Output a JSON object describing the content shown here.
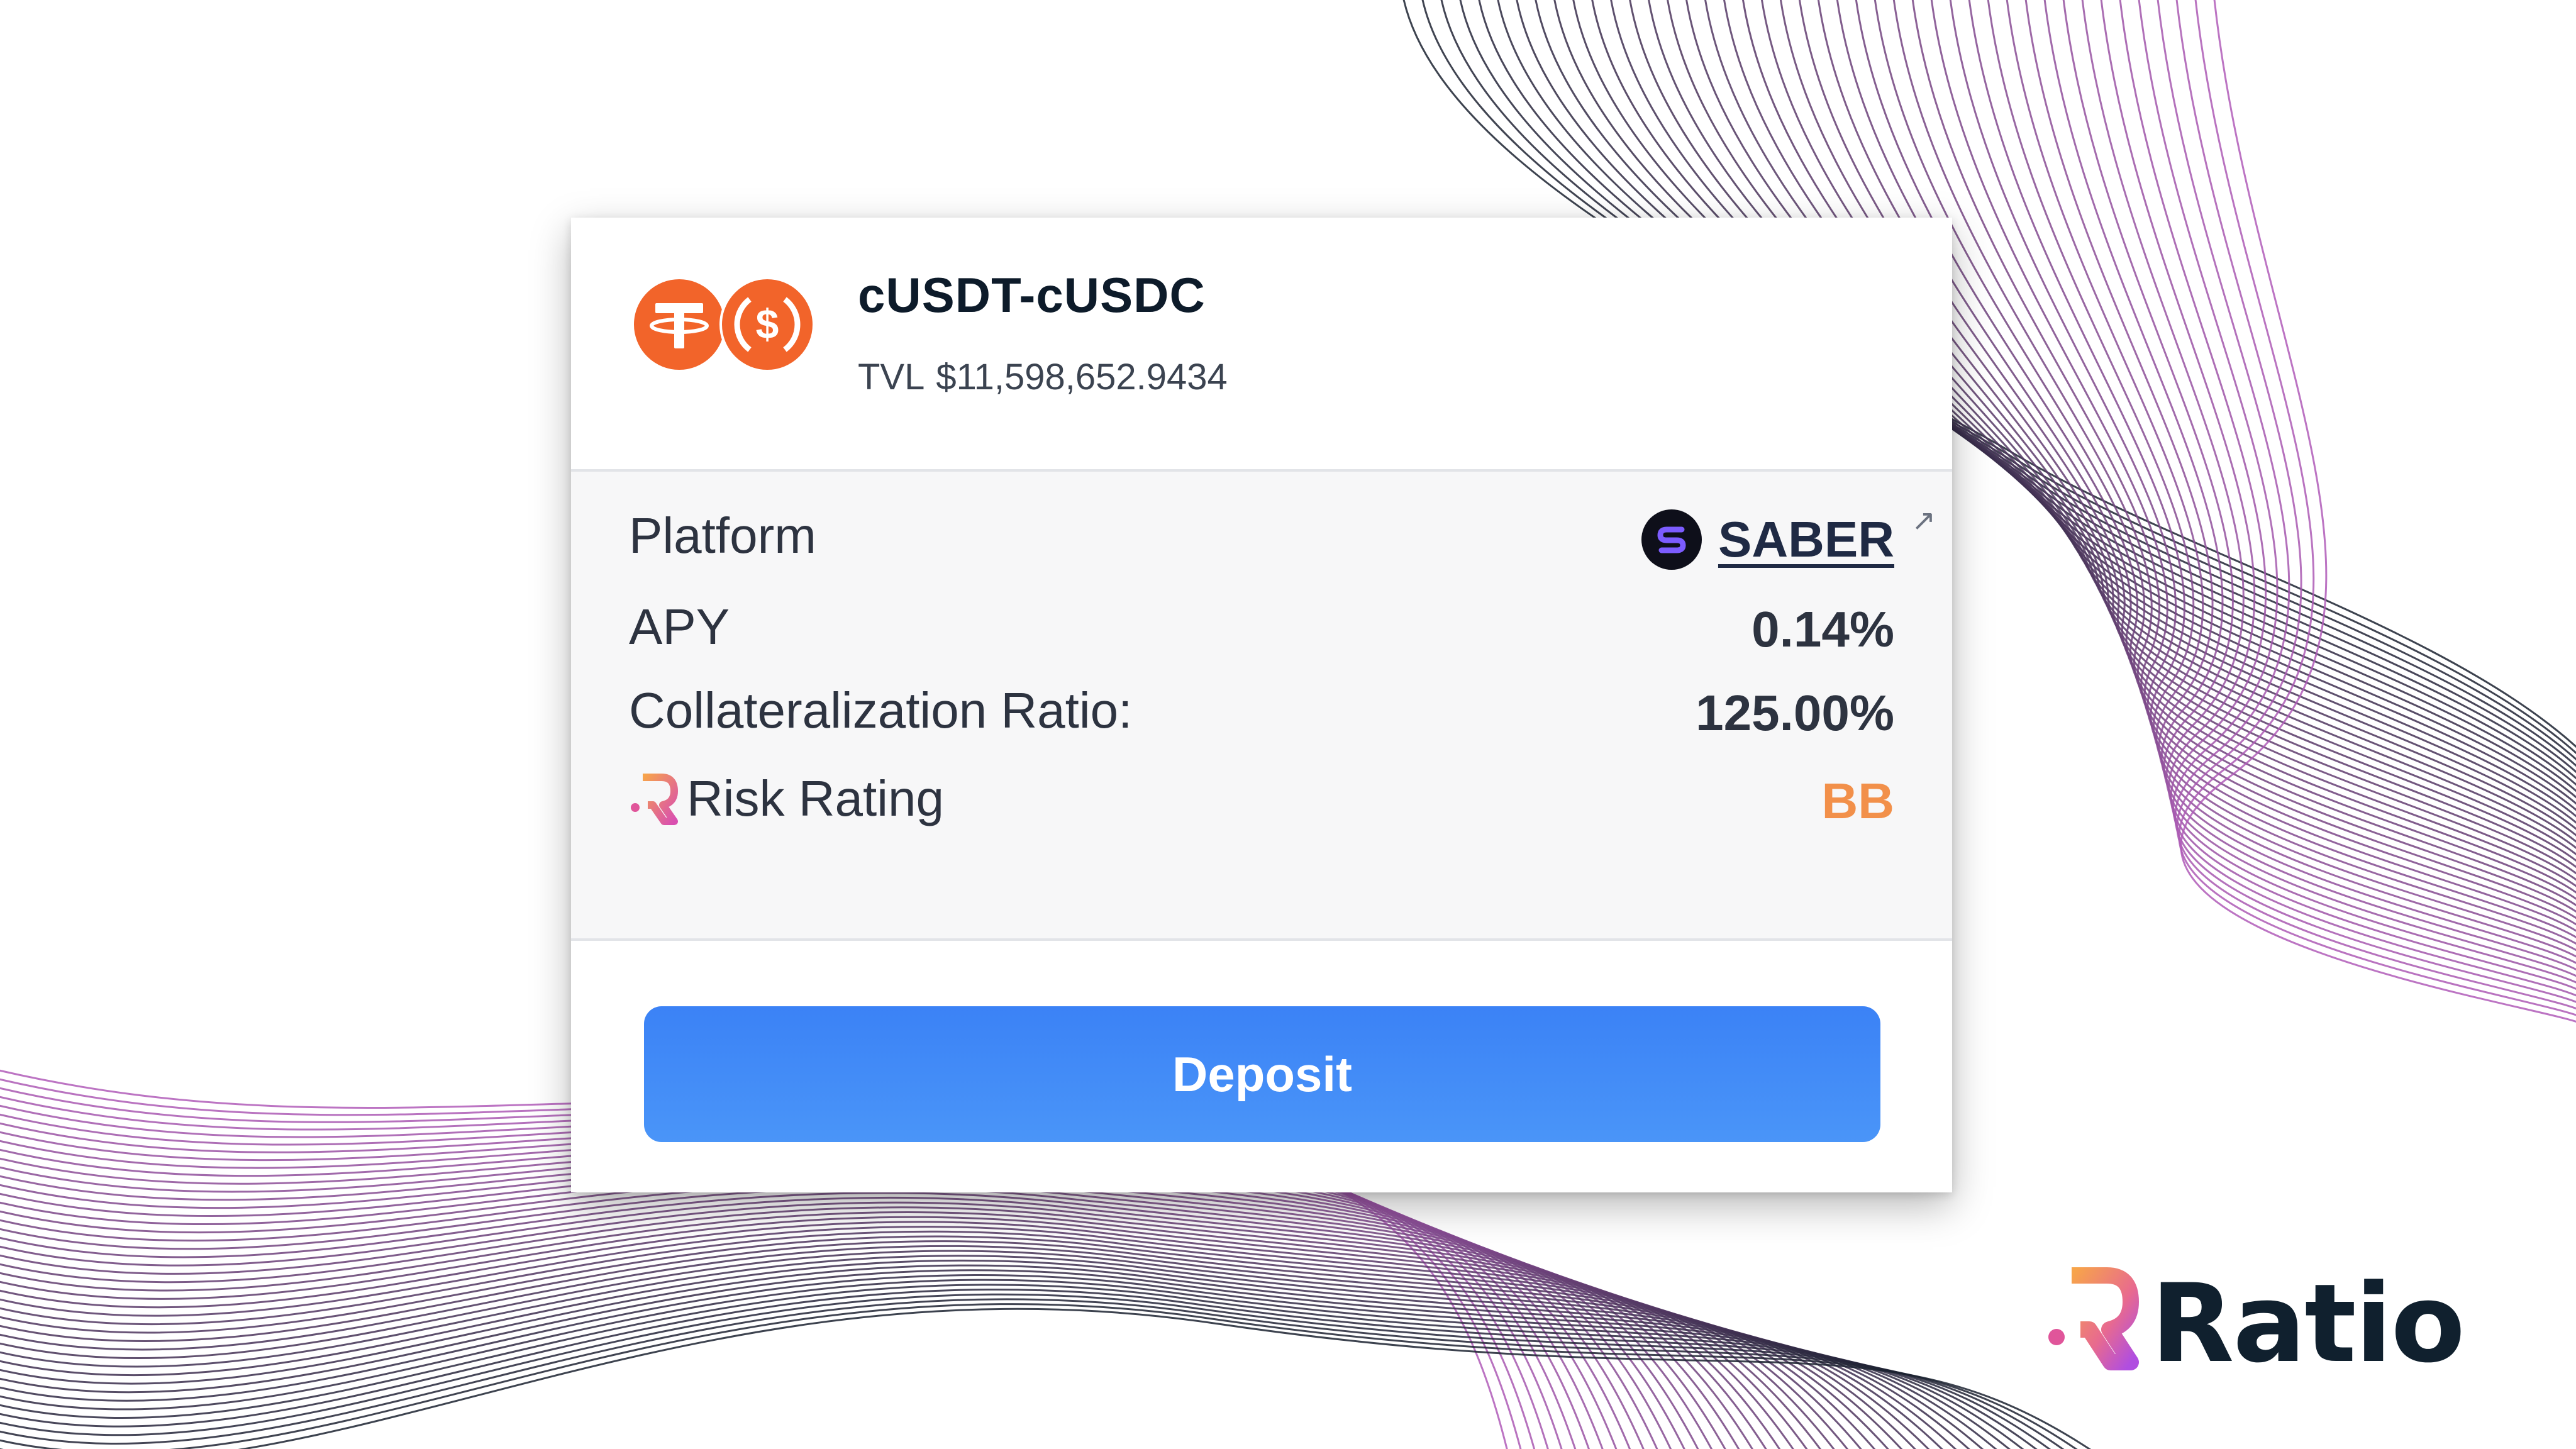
{
  "colors": {
    "accent_blue": "#3b82f6",
    "risk_orange": "#f2904a",
    "token_orange": "#f2642a",
    "text_dark": "#0d1b2a",
    "wave_purple": "#b05cb8",
    "wave_dark": "#1b2230"
  },
  "pool": {
    "name": "cUSDT-cUSDC",
    "tvl_label": "TVL",
    "tvl_value": "$11,598,652.9434",
    "icons": [
      "tether-icon",
      "usdc-icon"
    ]
  },
  "details": {
    "platform_label": "Platform",
    "platform_value": "SABER",
    "platform_icon": "saber-logo-icon",
    "external_icon": "external-link-icon",
    "apy_label": "APY",
    "apy_value": "0.14%",
    "collateral_label": "Collateralization Ratio:",
    "collateral_value": "125.00%",
    "risk_label": "Risk Rating",
    "risk_value": "BB"
  },
  "actions": {
    "deposit_label": "Deposit"
  },
  "brand": {
    "name": "Ratio"
  }
}
